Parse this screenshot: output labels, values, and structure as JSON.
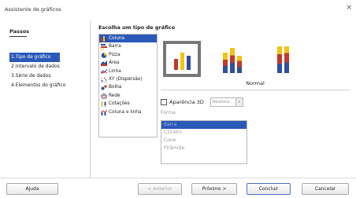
{
  "window": {
    "title": "Assistente de gráficos",
    "close_glyph": "×"
  },
  "steps": {
    "header": "Passos",
    "items": [
      {
        "label": "1.Tipo de gráfico",
        "active": true
      },
      {
        "label": "2.Intervalo de dados",
        "active": false
      },
      {
        "label": "3.Série de dados",
        "active": false
      },
      {
        "label": "4.Elementos do gráfico",
        "active": false
      }
    ]
  },
  "chart_type": {
    "heading": "Escolha um tipo de gráfico",
    "types": [
      {
        "label": "Coluna",
        "icon": "column-chart-icon",
        "selected": true
      },
      {
        "label": "Barra",
        "icon": "bar-chart-icon"
      },
      {
        "label": "Pizza",
        "icon": "pie-chart-icon"
      },
      {
        "label": "Área",
        "icon": "area-chart-icon"
      },
      {
        "label": "Linha",
        "icon": "line-chart-icon"
      },
      {
        "label": "XY (Dispersão)",
        "icon": "scatter-chart-icon"
      },
      {
        "label": "Bolha",
        "icon": "bubble-chart-icon"
      },
      {
        "label": "Rede",
        "icon": "net-chart-icon"
      },
      {
        "label": "Cotações",
        "icon": "stock-chart-icon"
      },
      {
        "label": "Coluna e linha",
        "icon": "column-line-chart-icon"
      }
    ],
    "variant_label": "Normal"
  },
  "options": {
    "appearance_3d_label": "Aparência 3D",
    "appearance_3d_checked": false,
    "realism_select": "Realista",
    "shape_label": "Forma",
    "shapes": [
      {
        "label": "Barra",
        "selected": true
      },
      {
        "label": "Cilindro"
      },
      {
        "label": "Cone"
      },
      {
        "label": "Pirâmide"
      }
    ]
  },
  "buttons": {
    "help": "Ajuda",
    "back": "< Anterior",
    "next": "Próximo >",
    "finish": "Concluir",
    "cancel": "Cancelar"
  },
  "colors": {
    "accent": "#2a59b8",
    "bar_blue": "#2f4f9f",
    "bar_red": "#c0392b",
    "bar_yellow": "#f1c40f"
  }
}
